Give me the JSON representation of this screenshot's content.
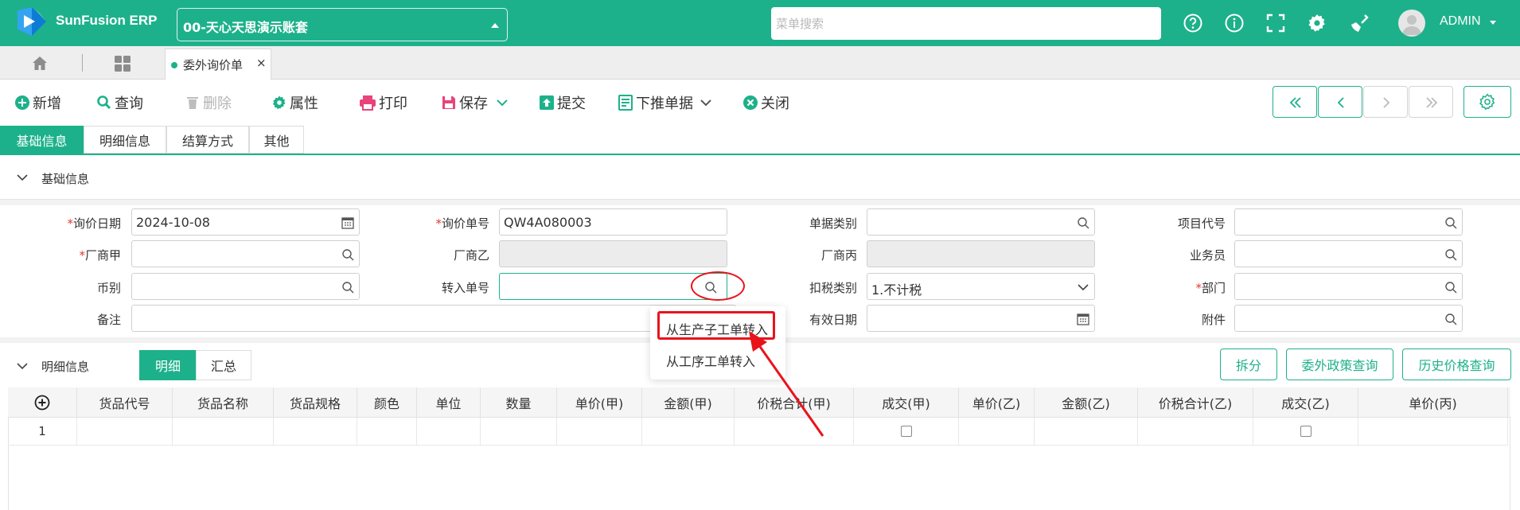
{
  "app": {
    "brand": "SunFusion ERP",
    "account": "00-天心天思演示账套",
    "search_placeholder": "菜单搜索",
    "user": "ADMIN",
    "accent": "#1db18b"
  },
  "tabs": {
    "open_doc": "委外询价单",
    "close": "×"
  },
  "toolbar": {
    "new": "新增",
    "query": "查询",
    "delete": "删除",
    "properties": "属性",
    "print": "打印",
    "save": "保存",
    "submit": "提交",
    "push_down": "下推单据",
    "close": "关闭"
  },
  "form_tabs": [
    "基础信息",
    "明细信息",
    "结算方式",
    "其他"
  ],
  "basic": {
    "section_title": "基础信息",
    "labels": {
      "inquiry_date": "询价日期",
      "inquiry_no": "询价单号",
      "doc_type": "单据类别",
      "project_code": "项目代号",
      "vendor_a": "厂商甲",
      "vendor_b": "厂商乙",
      "vendor_c": "厂商丙",
      "salesman": "业务员",
      "currency": "币别",
      "transfer_no": "转入单号",
      "tax_type": "扣税类别",
      "department": "部门",
      "remark": "备注",
      "valid_date": "有效日期",
      "attachment": "附件"
    },
    "required_mark": "*",
    "values": {
      "inquiry_date": "2024-10-08",
      "inquiry_no": "QW4A080003",
      "tax_type": "1.不计税"
    }
  },
  "popup": {
    "items": [
      "从生产子工单转入",
      "从工序工单转入"
    ]
  },
  "detail": {
    "section_title": "明细信息",
    "tabs": [
      "明细",
      "汇总"
    ],
    "buttons": [
      "拆分",
      "委外政策查询",
      "历史价格查询"
    ],
    "columns": [
      "货品代号",
      "货品名称",
      "货品规格",
      "颜色",
      "单位",
      "数量",
      "单价(甲)",
      "金额(甲)",
      "价税合计(甲)",
      "成交(甲)",
      "单价(乙)",
      "金额(乙)",
      "价税合计(乙)",
      "成交(乙)",
      "单价(丙)"
    ],
    "rows": [
      {
        "no": "1",
        "deal_a": false,
        "deal_b": false
      }
    ]
  }
}
